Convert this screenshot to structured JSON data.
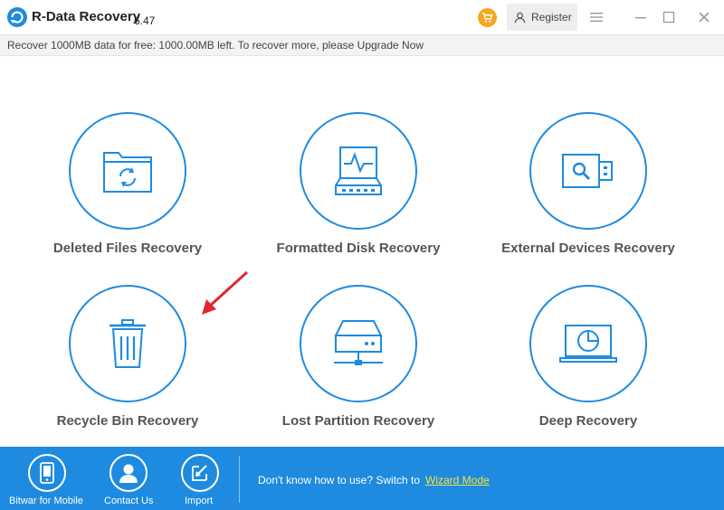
{
  "app": {
    "title": "R-Data Recovery",
    "version": "6.47",
    "register_label": "Register"
  },
  "infobar": {
    "message": "Recover 1000MB data for free: 1000.00MB left. To recover more, please Upgrade Now"
  },
  "tiles": [
    {
      "label": "Deleted Files Recovery",
      "icon": "folder-recycle-icon"
    },
    {
      "label": "Formatted Disk Recovery",
      "icon": "disk-pulse-icon"
    },
    {
      "label": "External Devices Recovery",
      "icon": "usb-drive-icon"
    },
    {
      "label": "Recycle Bin Recovery",
      "icon": "trash-bin-icon"
    },
    {
      "label": "Lost Partition Recovery",
      "icon": "network-drive-icon"
    },
    {
      "label": "Deep Recovery",
      "icon": "laptop-clock-icon"
    }
  ],
  "bottom": {
    "items": [
      {
        "label": "Bitwar for Mobile",
        "icon": "mobile-icon"
      },
      {
        "label": "Contact Us",
        "icon": "person-icon"
      },
      {
        "label": "Import",
        "icon": "import-icon"
      }
    ],
    "hint": "Don't know how to use? Switch to",
    "wizard_label": "Wizard Mode"
  },
  "colors": {
    "accent": "#1e8be0",
    "cart": "#f5a623",
    "wizard_link": "#f6e23a",
    "annotation_arrow": "#e0282e"
  }
}
